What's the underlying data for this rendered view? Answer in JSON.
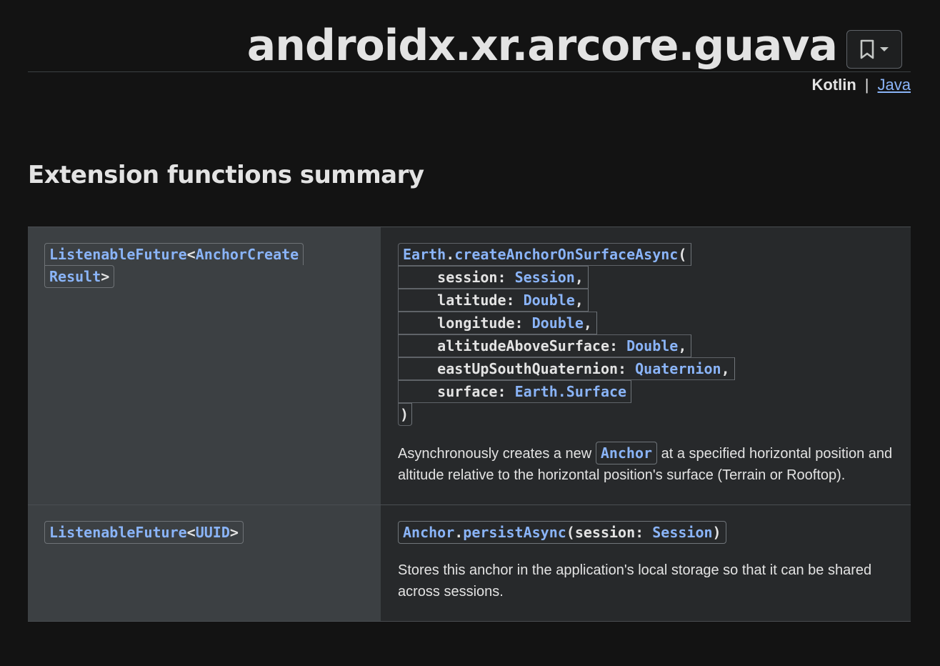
{
  "header": {
    "title": "androidx.xr.arcore.guava",
    "bookmark_icon": "bookmark-icon",
    "dropdown_icon": "chevron-down-icon"
  },
  "languages": {
    "current": "Kotlin",
    "separator": "|",
    "other": "Java"
  },
  "section": {
    "title": "Extension functions summary"
  },
  "rows": [
    {
      "return_type": {
        "t1": "ListenableFuture",
        "lt": "<",
        "t2a": "AnchorCreate",
        "t2b": "Result",
        "gt": ">"
      },
      "signature": {
        "receiver": "Earth",
        "dot": ".",
        "method": "createAnchorOnSurfaceAsync",
        "open": "(",
        "params": [
          {
            "name": "session",
            "type": "Session",
            "sep": ","
          },
          {
            "name": "latitude",
            "type": "Double",
            "sep": ","
          },
          {
            "name": "longitude",
            "type": "Double",
            "sep": ","
          },
          {
            "name": "altitudeAboveSurface",
            "type": "Double",
            "sep": ","
          },
          {
            "name": "eastUpSouthQuaternion",
            "type": "Quaternion",
            "sep": ","
          },
          {
            "name": "surface",
            "type": "Earth.Surface",
            "sep": ""
          }
        ],
        "close": ")"
      },
      "description": {
        "before": "Asynchronously creates a new ",
        "code": "Anchor",
        "after": " at a specified horizontal position and altitude relative to the horizontal position's surface (Terrain or Rooftop)."
      }
    },
    {
      "return_type": {
        "t1": "ListenableFuture",
        "lt": "<",
        "t2": "UUID",
        "gt": ">"
      },
      "signature": {
        "receiver": "Anchor",
        "dot": ".",
        "method": "persistAsync",
        "open": "(",
        "param_name": "session",
        "colon": ": ",
        "param_type": "Session",
        "close": ")"
      },
      "description": {
        "text": "Stores this anchor in the application's local storage so that it can be shared across sessions."
      }
    }
  ]
}
